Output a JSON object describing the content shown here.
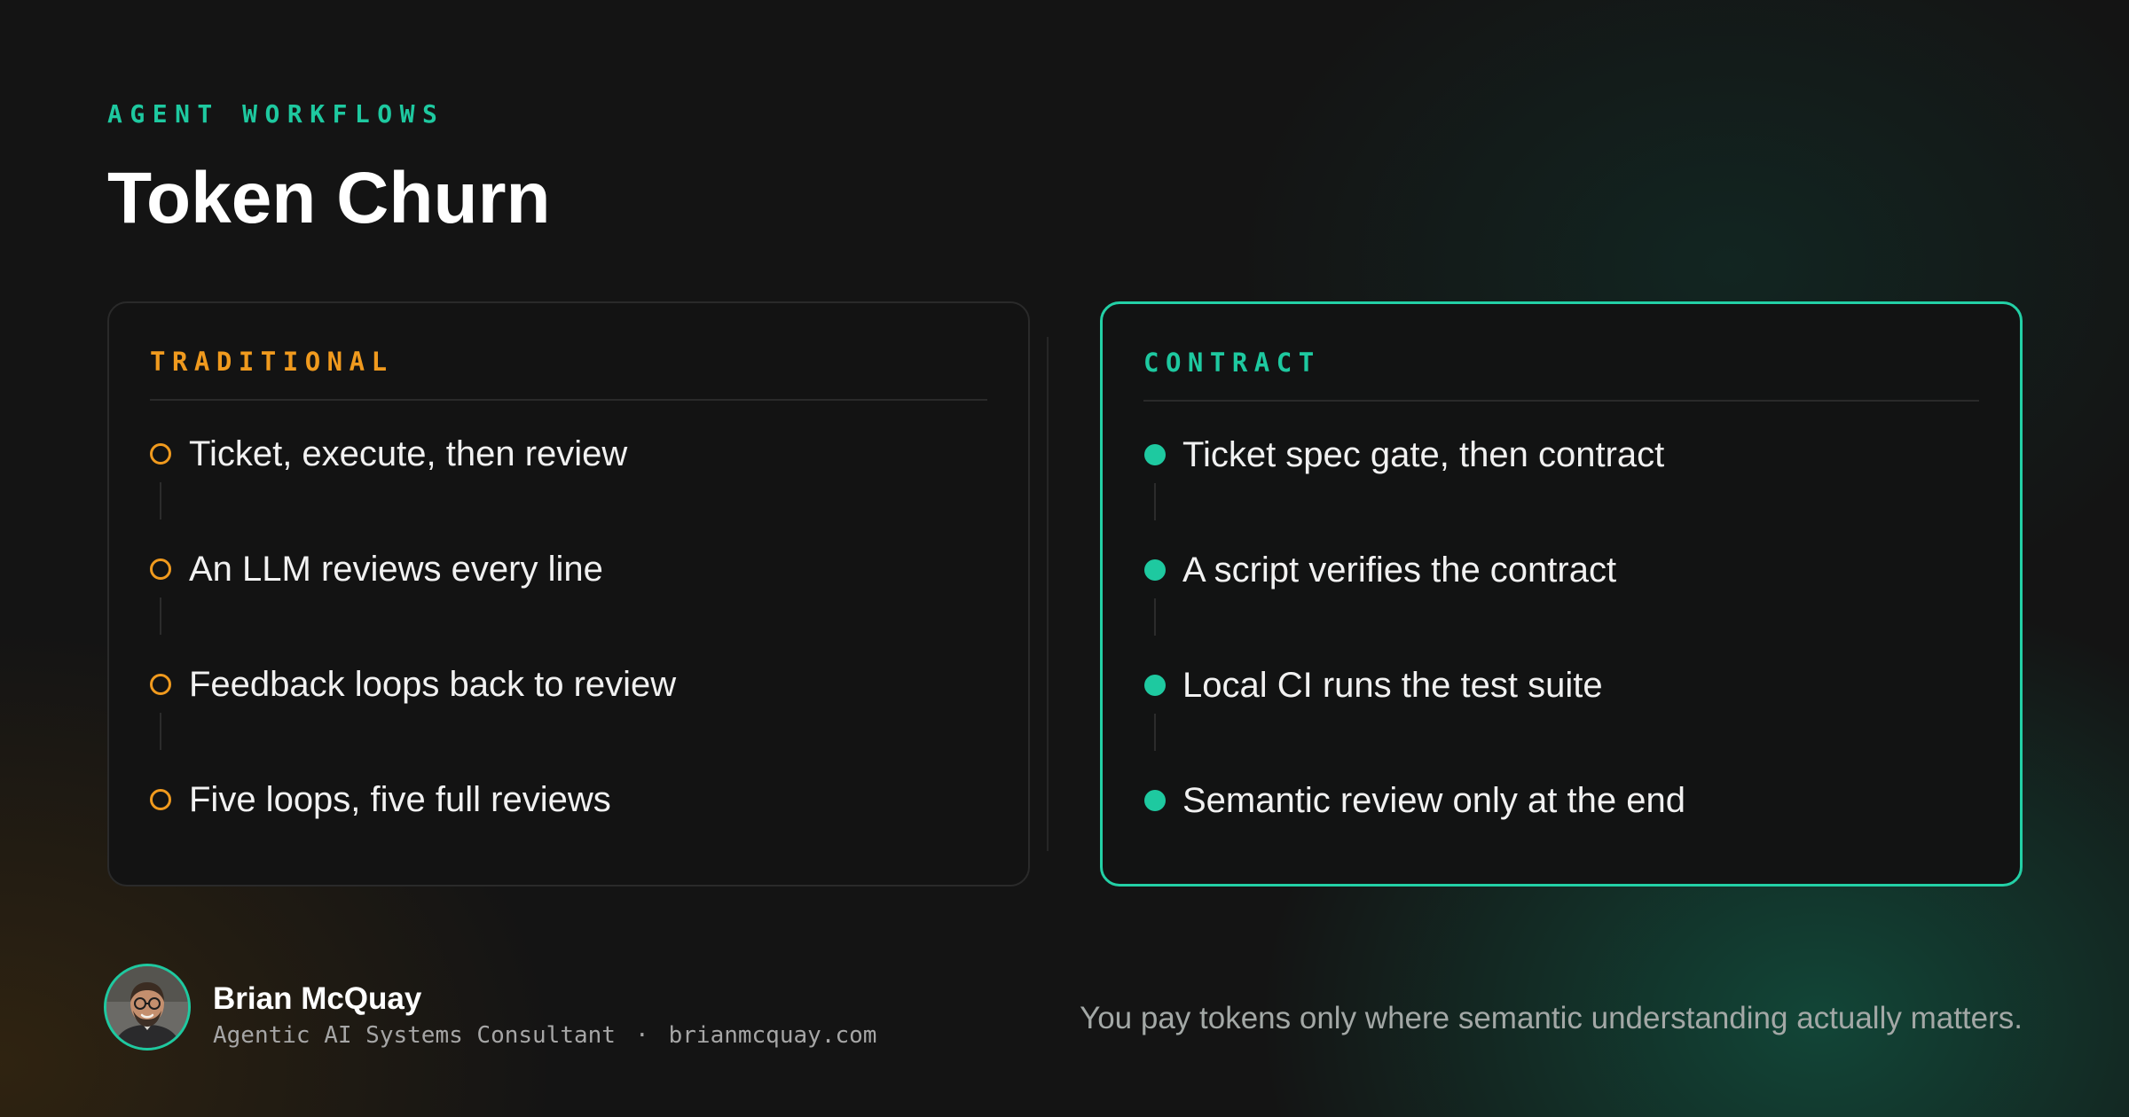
{
  "header": {
    "eyebrow": "AGENT WORKFLOWS",
    "title": "Token Churn"
  },
  "panels": {
    "traditional": {
      "heading": "TRADITIONAL",
      "steps": [
        "Ticket, execute, then review",
        "An LLM reviews every line",
        "Feedback loops back to review",
        "Five loops, five full reviews"
      ]
    },
    "contract": {
      "heading": "CONTRACT",
      "steps": [
        "Ticket spec gate, then contract",
        "A script verifies the contract",
        "Local CI runs the test suite",
        "Semantic review only at the end"
      ]
    }
  },
  "author": {
    "name": "Brian McQuay",
    "role": "Agentic AI Systems Consultant",
    "separator": "·",
    "website": "brianmcquay.com"
  },
  "tagline": "You pay tokens only where semantic understanding actually matters.",
  "colors": {
    "accent_teal": "#1ec9a0",
    "accent_orange": "#f09a1e",
    "background": "#141414"
  }
}
